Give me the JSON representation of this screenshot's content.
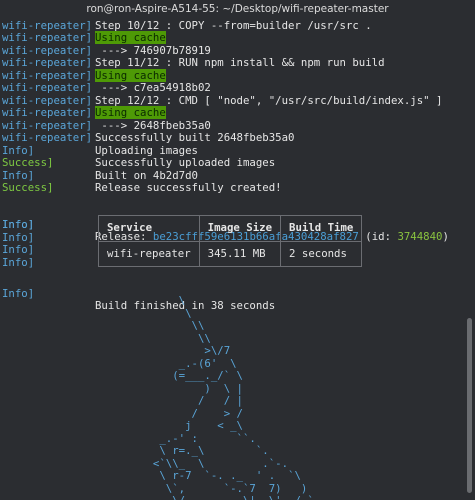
{
  "window": {
    "title": "ron@ron-Aspire-A514-55: ~/Desktop/wifi-repeater-master"
  },
  "lines": [
    {
      "prefix": "wifi-repeater]",
      "pcls": "blue",
      "msg": "Step 10/12 : COPY --from=builder /usr/src ."
    },
    {
      "prefix": "wifi-repeater]",
      "pcls": "blue",
      "msg": "Using cache",
      "hl": true
    },
    {
      "prefix": "wifi-repeater]",
      "pcls": "blue",
      "msg": " ---> 746907b78919"
    },
    {
      "prefix": "wifi-repeater]",
      "pcls": "blue",
      "msg": "Step 11/12 : RUN npm install && npm run build"
    },
    {
      "prefix": "wifi-repeater]",
      "pcls": "blue",
      "msg": "Using cache",
      "hl": true
    },
    {
      "prefix": "wifi-repeater]",
      "pcls": "blue",
      "msg": " ---> c7ea54918b02"
    },
    {
      "prefix": "wifi-repeater]",
      "pcls": "blue",
      "msg": "Step 12/12 : CMD [ \"node\", \"/usr/src/build/index.js\" ]"
    },
    {
      "prefix": "wifi-repeater]",
      "pcls": "blue",
      "msg": "Using cache",
      "hl": true
    },
    {
      "prefix": "wifi-repeater]",
      "pcls": "blue",
      "msg": " ---> 2648fbeb35a0"
    },
    {
      "prefix": "wifi-repeater]",
      "pcls": "blue",
      "msg": "Successfully built 2648fbeb35a0"
    },
    {
      "prefix": "Info]",
      "pcls": "blue",
      "msg": "Uploading images"
    },
    {
      "prefix": "Success]",
      "pcls": "green",
      "msg": "Successfully uploaded images"
    },
    {
      "prefix": "Info]",
      "pcls": "blue",
      "msg": "Built on 4b2d7d0"
    },
    {
      "prefix": "Success]",
      "pcls": "green",
      "msg": "Release successfully created!"
    }
  ],
  "release": {
    "prefix": "Info]",
    "label": "Release: ",
    "hash": "be23cfff59e6131b66afa430428af827",
    "id_open": " (id: ",
    "id": "3744840",
    "id_close": ")"
  },
  "info_prefix": "Info]",
  "table": {
    "headers": [
      "Service",
      "Image Size",
      "Build Time"
    ],
    "rows": [
      [
        "wifi-repeater",
        "345.11 MB",
        "2 seconds"
      ]
    ]
  },
  "finish": {
    "prefix": "Info]",
    "msg": "Build finished in 38 seconds"
  },
  "ascii_art": "             \\\n              \\\n               \\\\\n                \\\\\n                 >\\/7\n             _.-(6'  \\\n            (=___._/` \\\n                 )  \\ |\n                /   / |\n               /    > /\n              j    < _\\\n          _.-' :      ``.\n          \\ r=._\\        `.\n         <`\\\\_  \\         .`-.\n          \\ r-7  `-. ._  ' .  `\\\n           \\`,      `-.`7  7)   )\n            \\/         \\|  \\'  / `-._",
  "colors": {
    "background": "#2b2d31",
    "blue_prefix": "#5aa5d8",
    "green_prefix": "#7ec942",
    "cache_highlight": "#4e9a06",
    "hash": "#4a9ed6"
  }
}
